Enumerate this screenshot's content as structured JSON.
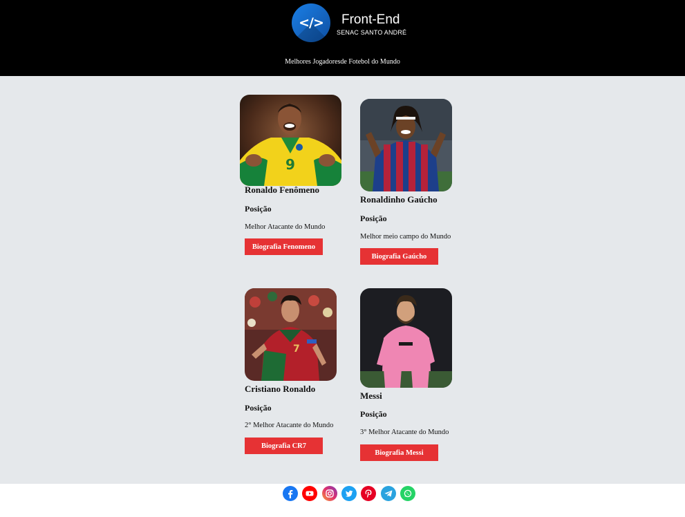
{
  "header": {
    "brand_title": "Front-End",
    "brand_subtitle": "SENAC SANTO ANDRÉ",
    "logo_glyph": "</>",
    "tagline": "Melhores Jogadoresde Fotebol do Mundo"
  },
  "players": [
    {
      "name": "Ronaldo Fenômeno",
      "position_label": "Posição",
      "description": "Melhor Atacante do Mundo",
      "button": "Biografia Fenomeno"
    },
    {
      "name": "Ronaldinho Gaúcho",
      "position_label": "Posição",
      "description": "Melhor meio campo do Mundo",
      "button": "Biografia Gaúcho"
    },
    {
      "name": "Cristiano Ronaldo",
      "position_label": "Posição",
      "description": "2° Melhor Atacante do Mundo",
      "button": "Biografia CR7"
    },
    {
      "name": "Messi",
      "position_label": "Posição",
      "description": "3° Melhor Atacante do Mundo",
      "button": "Biografia Messi"
    }
  ],
  "footer": {
    "social": [
      {
        "icon": "facebook-icon",
        "color": "#1877f2"
      },
      {
        "icon": "youtube-icon",
        "color": "#ff0000"
      },
      {
        "icon": "instagram-icon",
        "color": "#c13584"
      },
      {
        "icon": "twitter-icon",
        "color": "#1da1f2"
      },
      {
        "icon": "pinterest-icon",
        "color": "#e60023"
      },
      {
        "icon": "telegram-icon",
        "color": "#2aa3df"
      },
      {
        "icon": "whatsapp-icon",
        "color": "#25d366"
      }
    ]
  },
  "colors": {
    "header_bg": "#000000",
    "page_bg": "#e5e8eb",
    "button": "#e63234"
  }
}
